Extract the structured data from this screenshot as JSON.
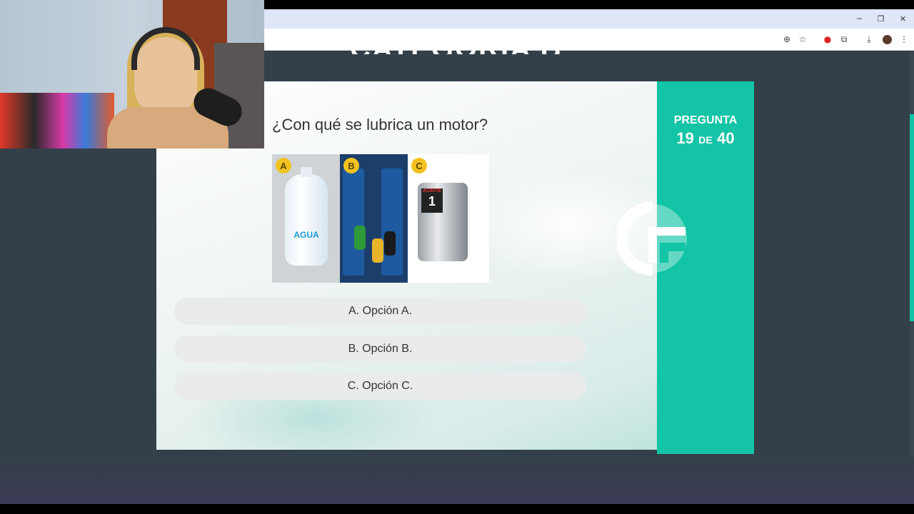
{
  "page": {
    "heading_partial": "CATEGORIA B"
  },
  "quiz": {
    "question": "¿Con qué se lubrica un motor?",
    "image_badges": [
      "A",
      "B",
      "C"
    ],
    "image_labels": {
      "a": "AGUA",
      "c_brand": "ACEITE",
      "c_number": "1"
    },
    "options": [
      "A. Opción A.",
      "B. Opción B.",
      "C. Opción C."
    ],
    "progress": {
      "label": "PREGUNTA",
      "current": "19",
      "separator": "DE",
      "total": "40"
    }
  },
  "colors": {
    "accent": "#13c4a6",
    "page_background": "#344049",
    "option_background": "#e9eceb"
  },
  "browser": {
    "toolbar_icons": [
      "zoom-icon",
      "star-icon",
      "extension-alert-icon",
      "puzzle-icon",
      "download-icon",
      "profile-avatar",
      "menu-icon"
    ],
    "window_controls": [
      "minimize",
      "restore",
      "close"
    ]
  }
}
